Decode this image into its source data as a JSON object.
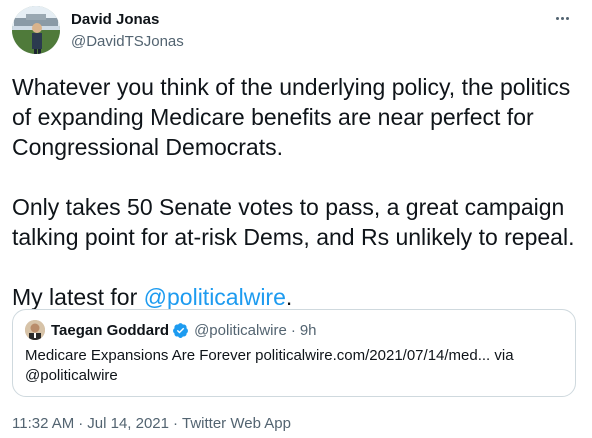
{
  "author": {
    "display_name": "David Jonas",
    "handle": "@DavidTSJonas"
  },
  "tweet": {
    "paragraph1": "Whatever you think of the underlying policy, the politics of expanding Medicare benefits are near perfect for Congressional Democrats.",
    "paragraph2": "Only takes 50 Senate votes to pass, a great campaign talking point for at-risk Dems, and Rs unlikely to repeal.",
    "paragraph3_prefix": "My latest for ",
    "paragraph3_mention": "@politicalwire",
    "paragraph3_suffix": "."
  },
  "quoted_tweet": {
    "display_name": "Taegan Goddard",
    "handle": "@politicalwire",
    "dot": "·",
    "time": "9h",
    "text": "Medicare Expansions Are Forever politicalwire.com/2021/07/14/med... via @politicalwire",
    "verified_icon": "verified-badge-icon"
  },
  "meta": {
    "time": "11:32 AM",
    "date": "Jul 14, 2021",
    "separator": "·",
    "source": "Twitter Web App"
  },
  "colors": {
    "link": "#1d9bf0",
    "secondary_text": "#536471",
    "primary_text": "#0f1419",
    "border": "#cfd9de"
  }
}
